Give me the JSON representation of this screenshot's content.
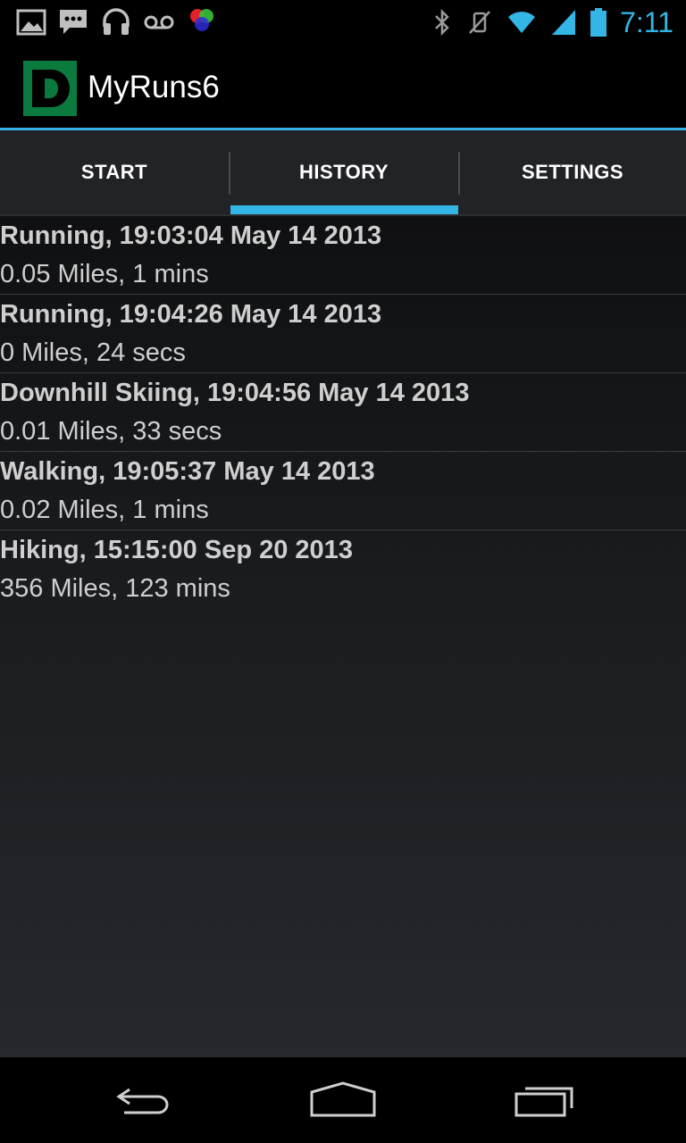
{
  "status_bar": {
    "time": "7:11",
    "left_icons": [
      "picture-icon",
      "messaging-icon",
      "headphones-icon",
      "voicemail-icon",
      "rgb-circles-icon"
    ],
    "right_icons": [
      "bluetooth-icon",
      "vibrate-icon",
      "wifi-icon",
      "signal-icon",
      "battery-icon"
    ],
    "accent_color": "#33b5e5"
  },
  "action_bar": {
    "title": "MyRuns6",
    "logo_letter": "D",
    "logo_color": "#0b7a3f"
  },
  "tabs": [
    {
      "label": "START",
      "selected": false
    },
    {
      "label": "HISTORY",
      "selected": true
    },
    {
      "label": "SETTINGS",
      "selected": false
    }
  ],
  "history": {
    "entries": [
      {
        "title": "Running, 19:03:04 May 14 2013",
        "subtitle": "0.05 Miles, 1 mins"
      },
      {
        "title": "Running, 19:04:26 May 14 2013",
        "subtitle": "0 Miles, 24 secs"
      },
      {
        "title": "Downhill Skiing, 19:04:56 May 14 2013",
        "subtitle": "0.01 Miles, 33 secs"
      },
      {
        "title": "Walking, 19:05:37 May 14 2013",
        "subtitle": "0.02 Miles, 1 mins"
      },
      {
        "title": "Hiking, 15:15:00 Sep 20 2013",
        "subtitle": "356 Miles, 123 mins"
      }
    ]
  },
  "nav_bar": {
    "buttons": [
      "back-icon",
      "home-icon",
      "recent-apps-icon"
    ]
  }
}
